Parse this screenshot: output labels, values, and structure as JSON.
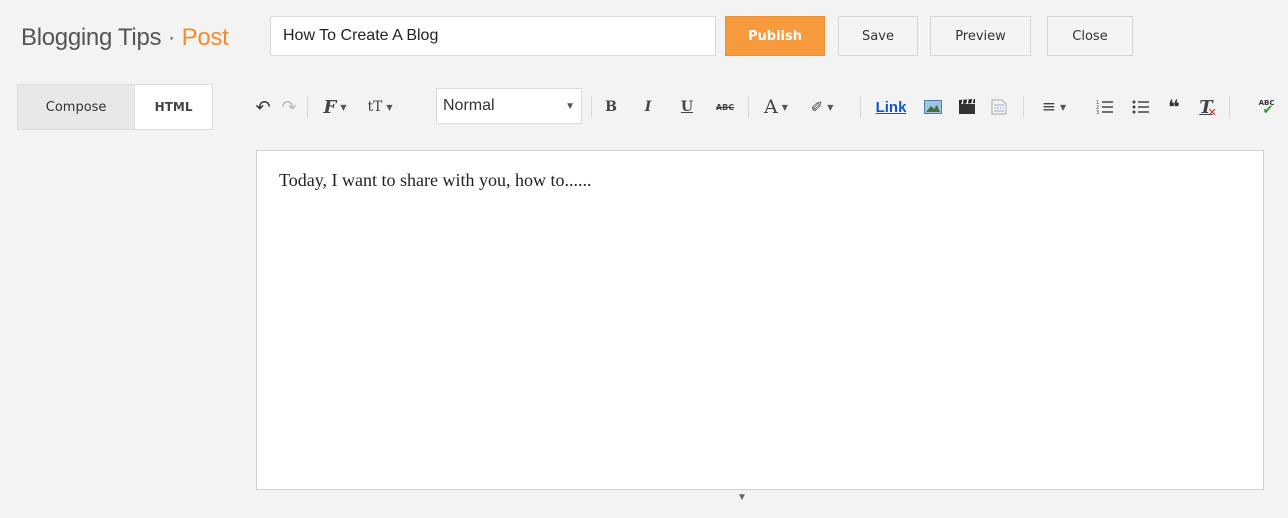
{
  "header": {
    "blog_name": "Blogging Tips",
    "separator": " · ",
    "section": "Post",
    "post_title_value": "How To Create A Blog",
    "buttons": {
      "publish": "Publish",
      "save": "Save",
      "preview": "Preview",
      "close": "Close"
    }
  },
  "mode_tabs": {
    "compose": "Compose",
    "html": "HTML"
  },
  "toolbar": {
    "format_value": "Normal",
    "link_label": "Link",
    "icons": [
      "undo-icon",
      "redo-icon",
      "font-family-icon",
      "font-size-icon",
      "format-select",
      "bold-icon",
      "italic-icon",
      "underline-icon",
      "strikethrough-icon",
      "text-color-icon",
      "highlight-icon",
      "link-button",
      "insert-image-icon",
      "insert-video-icon",
      "jump-break-icon",
      "align-icon",
      "numbered-list-icon",
      "bulleted-list-icon",
      "quote-icon",
      "remove-formatting-icon",
      "spell-check-icon"
    ],
    "glyphs": {
      "undo": "↶",
      "redo": "↷",
      "font": "𝓕",
      "size": "tT",
      "bold": "B",
      "italic": "I",
      "underline": "U",
      "strike": "ABC",
      "text_color": "A",
      "highlight": "✐",
      "align": "≡",
      "ol": "☰",
      "ul": "☰",
      "quote": "❝",
      "remove_format": "T",
      "spell": "ABC",
      "caret": "▼"
    }
  },
  "editor": {
    "body_text": "Today, I want to share with you, how to......"
  },
  "colors": {
    "accent": "#f48c2a",
    "publish": "#f69a3d",
    "link": "#1155cc"
  }
}
